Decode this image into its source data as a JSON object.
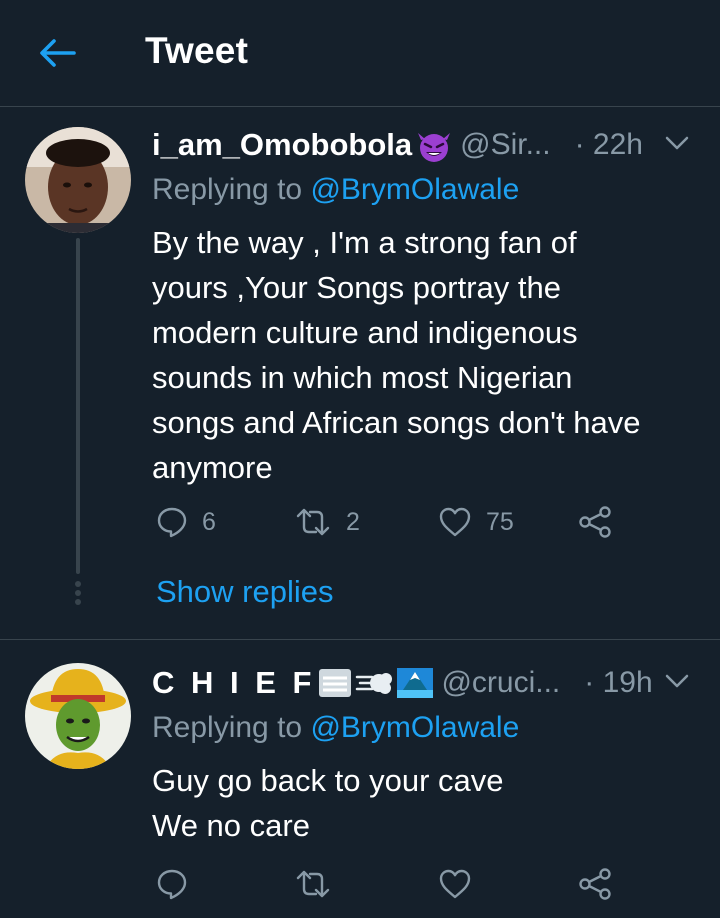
{
  "header": {
    "title": "Tweet",
    "back_icon": "arrow-left-icon"
  },
  "colors": {
    "background": "#15202b",
    "accent": "#1da1f2",
    "secondary_text": "#8899a6",
    "divider": "#38444d"
  },
  "tweets": [
    {
      "display_name": "i_am_Omobobola",
      "name_emoji": "smiling-devil-emoji",
      "handle": "@Sir...",
      "time": "· 22h",
      "replying_prefix": "Replying to ",
      "replying_to": "@BrymOlawale",
      "text": "By the way , I'm a strong fan of\nyours ,Your Songs portray the\nmodern culture and indigenous\nsounds in which most Nigerian\nsongs and African songs don't have\nanymore",
      "replies": "6",
      "retweets": "2",
      "likes": "75",
      "show_replies": "Show replies"
    },
    {
      "display_name": "C H I E F",
      "name_emoji": "fog-dash-mountain-emojis",
      "handle": "@cruci...",
      "time": "· 19h",
      "replying_prefix": "Replying to ",
      "replying_to": "@BrymOlawale",
      "text": "Guy go back to your cave\nWe no care",
      "replies": "",
      "retweets": "",
      "likes": ""
    }
  ]
}
